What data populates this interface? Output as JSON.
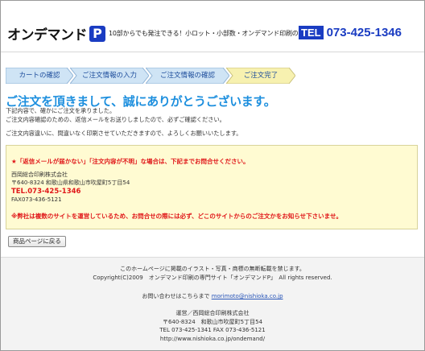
{
  "header": {
    "logo_text": "オンデマンド",
    "logo_mark": "P",
    "tagline": "10部からでも発注できる！小ロット・小部数・オンデマンド印刷の専門店",
    "tel_badge": "TEL",
    "tel_number": "073-425-1346"
  },
  "steps": [
    {
      "label": "カートの確認",
      "active": false
    },
    {
      "label": "ご注文情報の入力",
      "active": false
    },
    {
      "label": "ご注文情報の確認",
      "active": false
    },
    {
      "label": "ご注文完了",
      "active": true
    }
  ],
  "main": {
    "heading": "ご注文を頂きまして、誠にありがとうございます。",
    "line1": "下記内容で、確かにご注文を承りました。",
    "line2": "ご注文内容確認のための、返信メールをお送りしましたので、必ずご確認ください。",
    "line3": "ご注文内容違いに、間違いなく印刷させていただきますので、よろしくお願いいたします。"
  },
  "notice": {
    "warn1": "★「返信メールが届かない」「注文内容が不明」な場合は、下記までお問合せください。",
    "company": "西岡総合印刷株式会社",
    "address": "〒640-8324 和歌山県和歌山市吹屋町5丁目54",
    "tel": "TEL.073-425-1346",
    "fax": "FAX073-436-5121",
    "warn2": "※弊社は複数のサイトを運営しているため、お問合せの際には必ず、どこのサイトからのご注文かをお知らせ下さいませ。"
  },
  "back_button": "商品ページに戻る",
  "footer": {
    "copy_notice": "このホームページに掲載のイラスト・写真・商標の無断転載を禁じます。",
    "copyright": "Copyright(C)2009　オンデマンド印刷の専門サイト「オンデマンドP」　All rights reserved.",
    "contact_label": "お問い合わせはこちらまで",
    "contact_email": "morimoto@nishioka.co.jp",
    "operator": "運営／西岡総合印刷株式会社",
    "address": "〒640-8324　和歌山市吹屋町5丁目54",
    "telfax": "TEL 073-425-1341 FAX 073-436-5121",
    "url": "http://www.nishioka.co.jp/ondemand/"
  },
  "colors": {
    "brand_blue": "#1a3cc2",
    "heading_blue": "#1d8fde",
    "warning_red": "#e0181a",
    "step_blue": "#cfe4f5",
    "step_active": "#f7f1b0",
    "notice_bg": "#fffbd2"
  }
}
